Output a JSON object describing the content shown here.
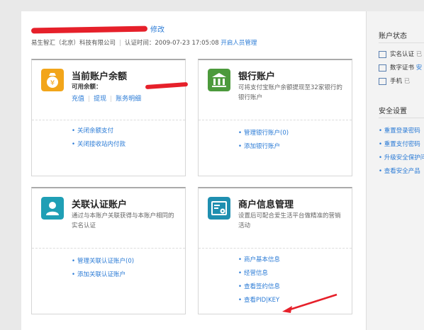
{
  "header": {
    "edit_label": "修改",
    "company": "易生智汇（北京）科技有限公司",
    "cert_time_label": "认证时间：2009-07-23 17:05:08",
    "manager_link": "开启人员管理"
  },
  "cards": {
    "balance": {
      "title": "当前账户余额",
      "available_label": "可用余额：",
      "actions": [
        "充值",
        "提现",
        "账务明细"
      ],
      "links": [
        "关闭余额支付",
        "关闭接收站内付款"
      ]
    },
    "bank": {
      "title": "银行账户",
      "desc": "可将支付宝账户余额提现至32家银行的银行账户",
      "links": [
        "管理银行账户(0)",
        "添加银行账户"
      ]
    },
    "linked": {
      "title": "关联认证账户",
      "desc": "通过与本账户关联获得与本账户相同的实名认证",
      "links": [
        "管理关联认证账户(0)",
        "添加关联认证账户"
      ]
    },
    "merchant": {
      "title": "商户信息管理",
      "desc": "设置后可配合爱生活平台做精准的营销活动",
      "links": [
        "商户基本信息",
        "经营信息",
        "查看签约信息",
        "查看PID|KEY"
      ]
    }
  },
  "sidebar": {
    "status_title": "账户状态",
    "status_items": [
      {
        "label": "实名认证",
        "extra": "已"
      },
      {
        "label": "数字证书",
        "extra": "安"
      },
      {
        "label": "手机",
        "extra": "已"
      }
    ],
    "security_title": "安全设置",
    "security_links": [
      "重置登录密码",
      "重置支付密码",
      "升级安全保护问",
      "查看安全产品"
    ]
  },
  "colors": {
    "link": "#2b7bd6",
    "redaction": "#e6202a",
    "annotation_arrow": "#e6202a"
  }
}
